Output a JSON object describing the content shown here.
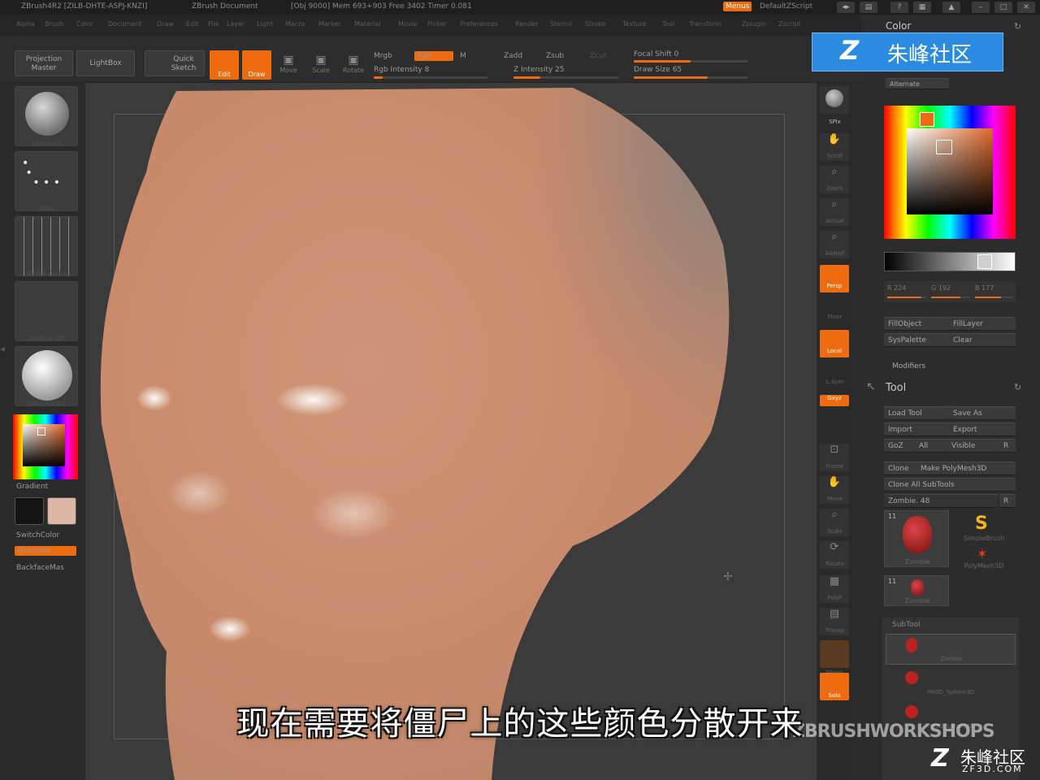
{
  "titlebar": {
    "app": "ZBrush4R2 [ZILB-DHTE-ASPJ-KNZI]",
    "document": "ZBrush Document",
    "stats": "[Obj 9000] Mem 693+903 Free 3402 Timer 0.081",
    "menus_label": "Menus",
    "script_label": "DefaultZScript"
  },
  "menubar": [
    "Alpha",
    "Brush",
    "Color",
    "Document",
    "Draw",
    "Edit",
    "File",
    "Layer",
    "Light",
    "Macro",
    "Marker",
    "Material",
    "Movie",
    "Picker",
    "Preferences",
    "Render",
    "Stencil",
    "Stroke",
    "Texture",
    "Tool",
    "Transform",
    "Zplugin",
    "Zscript"
  ],
  "shelf": {
    "projection_master": "Projection Master",
    "lightbox": "LightBox",
    "quick_sketch": "Quick Sketch",
    "edit": "Edit",
    "draw": "Draw",
    "move": "Move",
    "scale": "Scale",
    "rotate": "Rotate",
    "mrgb": "Mrgb",
    "rgb": "Rgb",
    "m": "M",
    "rgb_intensity": "Rgb Intensity 8",
    "zadd": "Zadd",
    "zsub": "Zsub",
    "zcut": "Zcut",
    "z_intensity": "Z Intensity 25",
    "focal_shift": "Focal Shift 0",
    "draw_size": "Draw Size 65",
    "rgb_intensity_level": 0.08,
    "z_intensity_level": 0.25,
    "focal_shift_level": 0.5,
    "draw_size_level": 0.65
  },
  "left": {
    "thumb_captions": [
      "Standard",
      "Dots",
      "Stroke Alpha",
      "Texture Off",
      "SkinShade4"
    ],
    "gradient": "Gradient",
    "switchcolor": "SwitchColor",
    "alternate": "Alternate",
    "backface": "BackfaceMas",
    "main_color": "#dcb6a3",
    "secondary_color": "#141414"
  },
  "right_shelf": [
    "SPix",
    "Scroll",
    "Zoom",
    "Actual",
    "AAHalf",
    "Persp",
    "Floor",
    "Local",
    "L.Sym",
    "Gxyz",
    "Frame",
    "Move",
    "Scale",
    "Rotate",
    "PolyF",
    "Transp",
    "Ghost",
    "Solo"
  ],
  "color_palette": {
    "title": "Color",
    "alternate": "Alternate",
    "r": "R 224",
    "g": "G 192",
    "b": "B 177",
    "fill_object": "FillObject",
    "fill_layer": "FillLayer",
    "sys_palette": "SysPalette",
    "clear": "Clear",
    "modifiers": "Modifiers",
    "r_level": 0.878,
    "g_level": 0.753,
    "b_level": 0.694
  },
  "tool_palette": {
    "title": "Tool",
    "load_tool": "Load Tool",
    "save_as": "Save As",
    "import": "Import",
    "export": "Export",
    "goz": "GoZ",
    "all": "All",
    "visible": "Visible",
    "r": "R",
    "clone": "Clone",
    "make_polymesh": "Make PolyMesh3D",
    "clone_all": "Clone All SubTools",
    "current": "Zombie. 48",
    "count1": "11",
    "count2": "11",
    "zombie": "Zombie",
    "simplebrush": "SimpleBrush",
    "polymesh": "PolyMesh3D",
    "zombie2": "Zombie",
    "subtool": "SubTool",
    "sub1": "Zombie",
    "sub2": "PM3D_Sphere3D",
    "sub3": "PM3D_Sphere3D"
  },
  "subtitle": "现在需要将僵尸上的这些颜色分散开来",
  "workshops": "ZBRUSHWORKSHOPS",
  "watermark": {
    "top_text": "朱峰社区",
    "bottom_text": "朱峰社区",
    "bottom_url": "ZF3D.COM"
  }
}
